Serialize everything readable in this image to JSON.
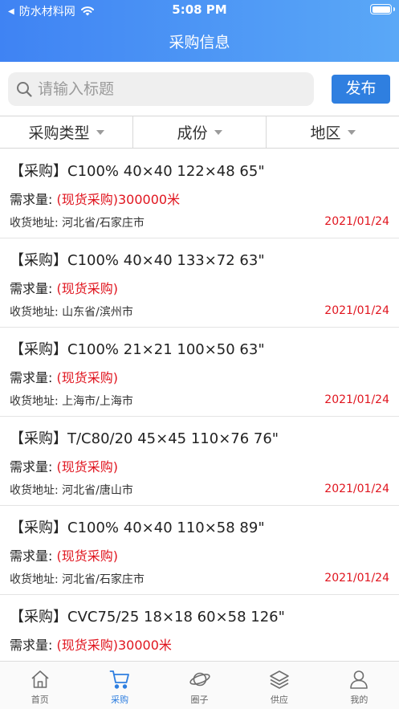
{
  "status_bar": {
    "back_label": "◀",
    "carrier": "防水材料网",
    "time": "5:08 PM"
  },
  "header": {
    "title": "采购信息"
  },
  "search": {
    "placeholder": "请输入标题",
    "publish_label": "发布"
  },
  "filters": [
    {
      "label": "采购类型"
    },
    {
      "label": "成份"
    },
    {
      "label": "地区"
    }
  ],
  "items": [
    {
      "title": "【采购】C100% 40×40 122×48 65\"",
      "demand_label": "需求量:",
      "demand_value": "(现货采购)300000米",
      "address": "收货地址: 河北省/石家庄市",
      "date": "2021/01/24"
    },
    {
      "title": "【采购】C100% 40×40 133×72 63\"",
      "demand_label": "需求量:",
      "demand_value": "(现货采购)",
      "address": "收货地址: 山东省/滨州市",
      "date": "2021/01/24"
    },
    {
      "title": "【采购】C100% 21×21 100×50 63\"",
      "demand_label": "需求量:",
      "demand_value": "(现货采购)",
      "address": "收货地址: 上海市/上海市",
      "date": "2021/01/24"
    },
    {
      "title": "【采购】T/C80/20 45×45 110×76 76\"",
      "demand_label": "需求量:",
      "demand_value": "(现货采购)",
      "address": "收货地址: 河北省/唐山市",
      "date": "2021/01/24"
    },
    {
      "title": "【采购】C100% 40×40 110×58 89\"",
      "demand_label": "需求量:",
      "demand_value": "(现货采购)",
      "address": "收货地址: 河北省/石家庄市",
      "date": "2021/01/24"
    },
    {
      "title": "【采购】CVC75/25 18×18 60×58 126\"",
      "demand_label": "需求量:",
      "demand_value": "(现货采购)30000米",
      "address": "",
      "date": ""
    }
  ],
  "tabbar": [
    {
      "label": "首页",
      "icon": "home-icon",
      "active": false
    },
    {
      "label": "采购",
      "icon": "cart-icon",
      "active": true
    },
    {
      "label": "圈子",
      "icon": "planet-icon",
      "active": false
    },
    {
      "label": "供应",
      "icon": "layers-icon",
      "active": false
    },
    {
      "label": "我的",
      "icon": "user-icon",
      "active": false
    }
  ],
  "colors": {
    "header_start": "#3f83f3",
    "header_end": "#5aa8f7",
    "accent": "#2f7fe0",
    "highlight_red": "#e0141e"
  }
}
